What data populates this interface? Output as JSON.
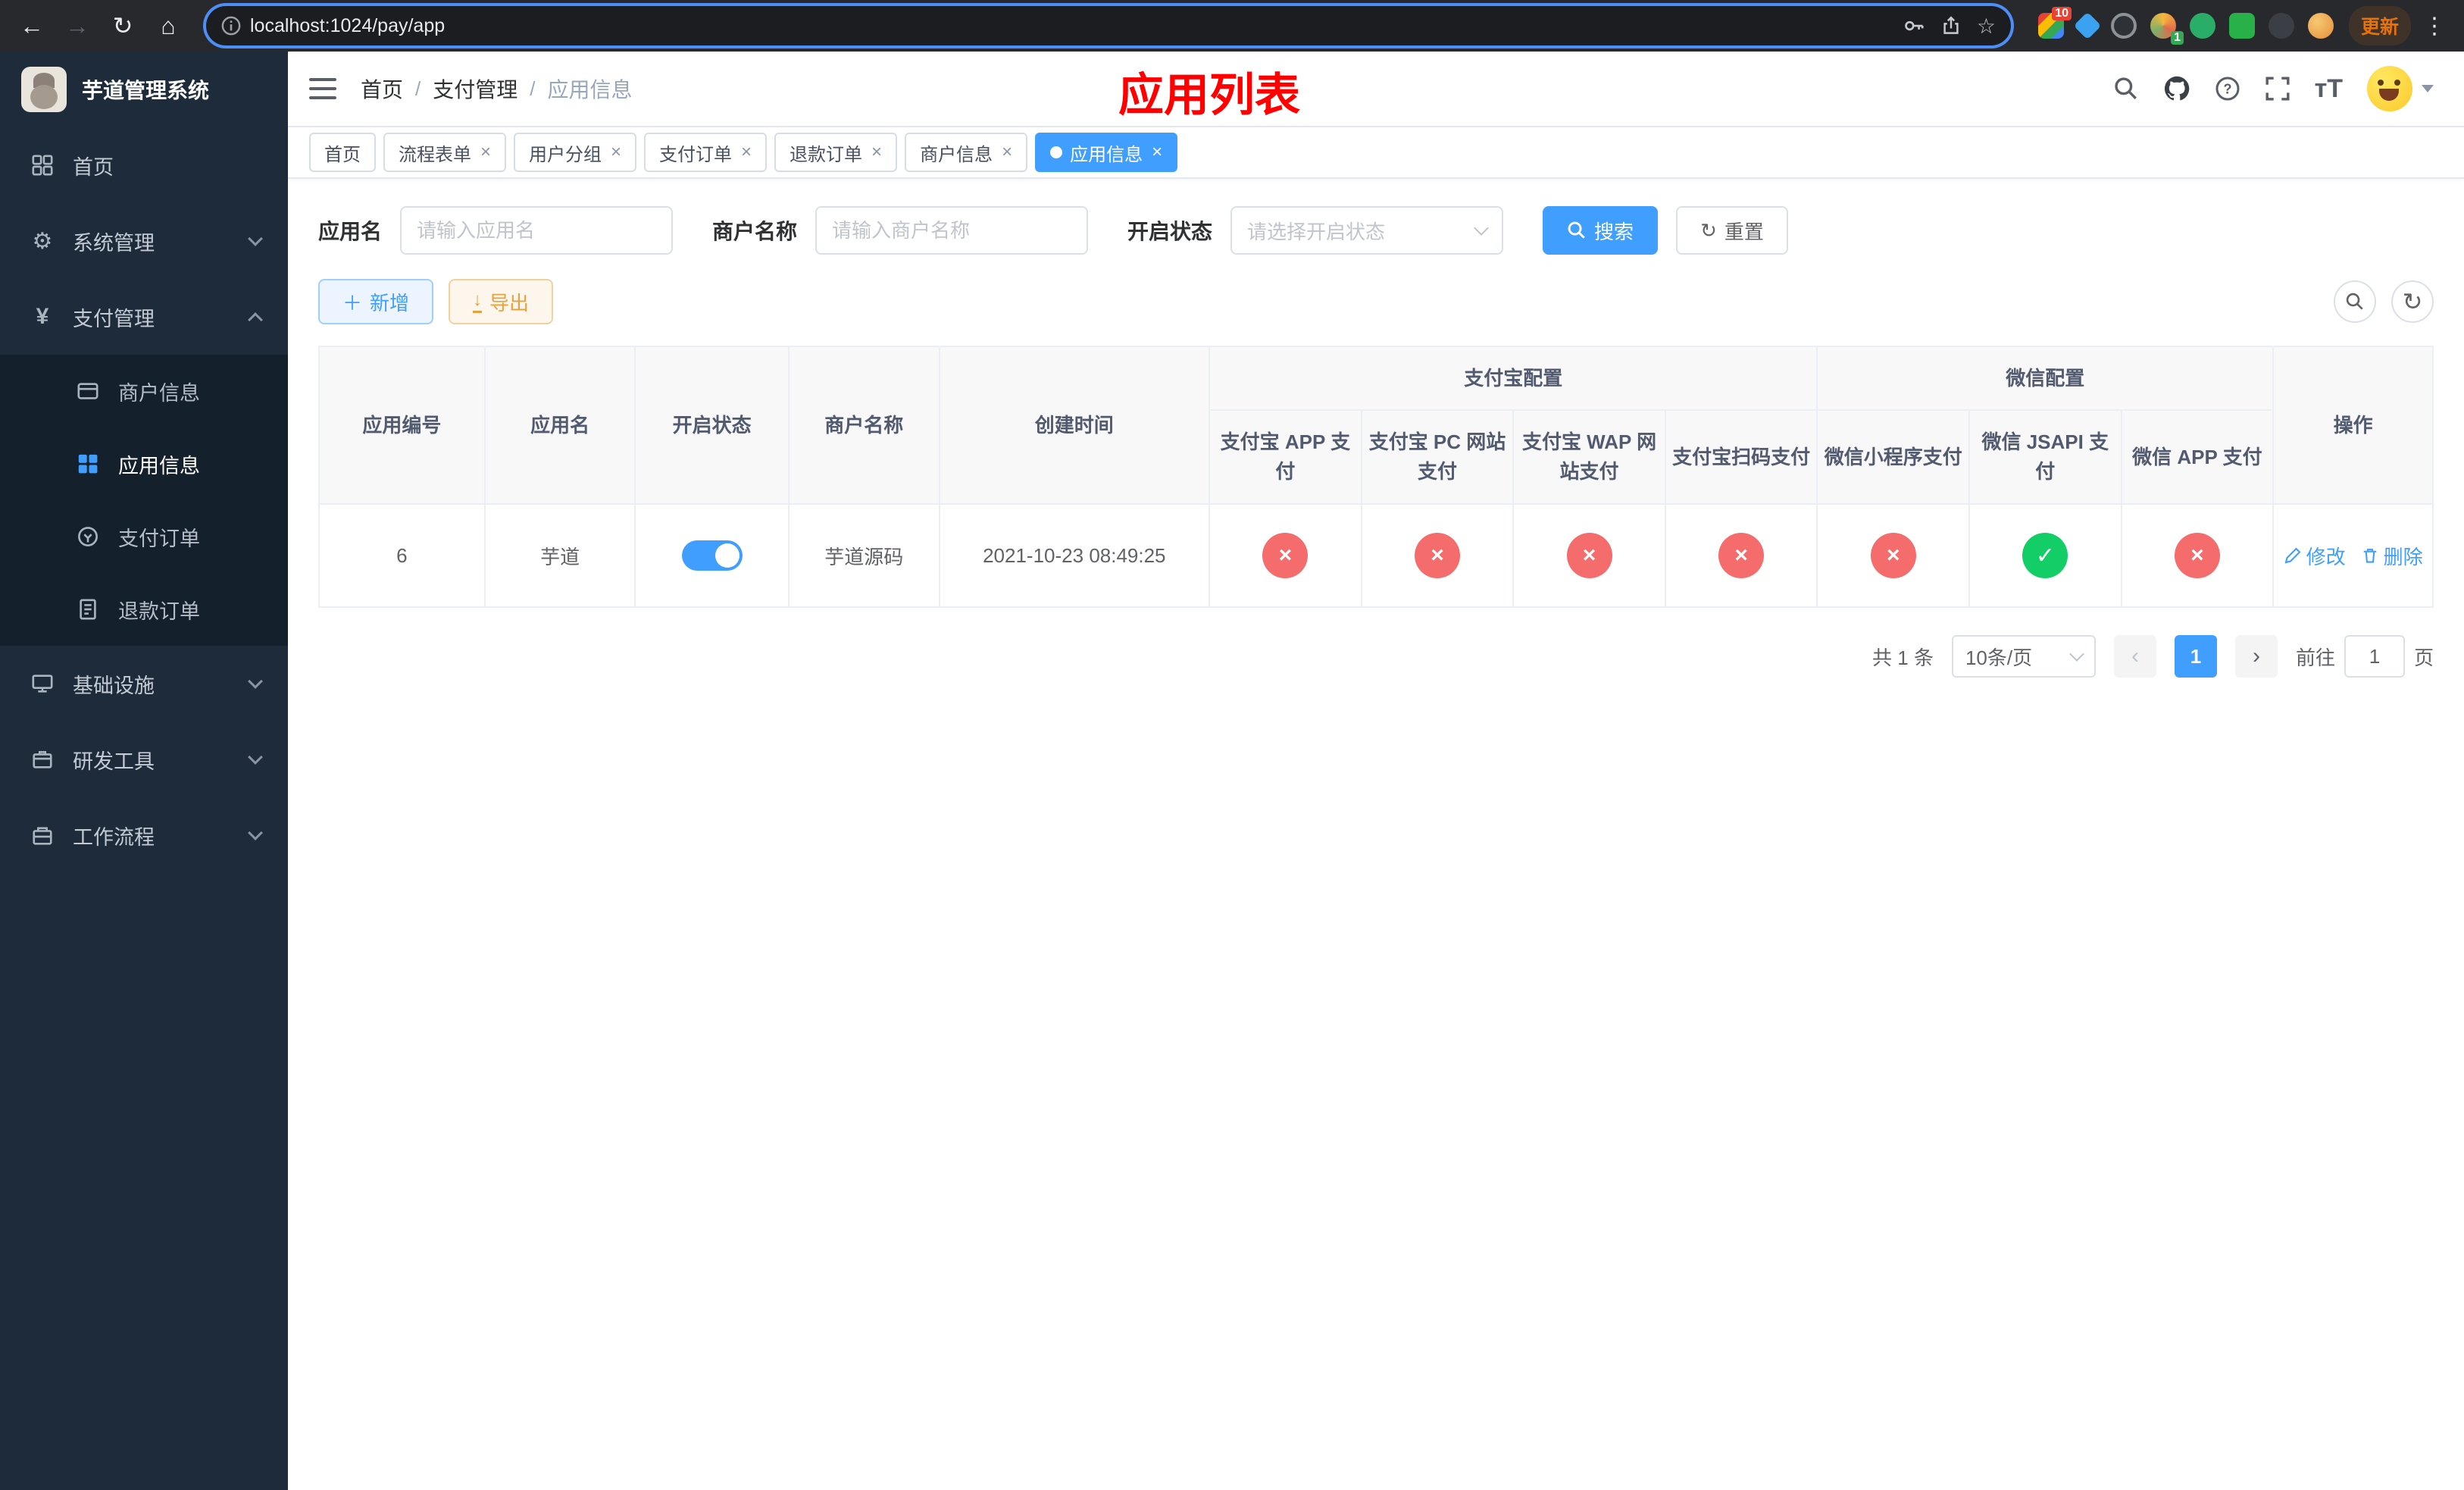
{
  "colors": {
    "accent": "#409eff",
    "danger": "#f56c6c",
    "success": "#13ce66",
    "warning": "#e6a23c",
    "title_red": "#ff0000",
    "sidebar_bg": "#1d2b3a"
  },
  "browser": {
    "url": "localhost:1024/pay/app",
    "update_button": "更新",
    "extension_badge_count": "10",
    "profile_badge_count": "1"
  },
  "sidebar": {
    "logo_title": "芋道管理系统",
    "menu": [
      {
        "label": "首页",
        "icon": "dashboard-icon",
        "expandable": false
      },
      {
        "label": "系统管理",
        "icon": "gear-icon",
        "expandable": true,
        "expanded": false
      },
      {
        "label": "支付管理",
        "icon": "yen-icon",
        "expandable": true,
        "expanded": true
      },
      {
        "label": "基础设施",
        "icon": "infrastructure-icon",
        "expandable": true,
        "expanded": false
      },
      {
        "label": "研发工具",
        "icon": "devtools-icon",
        "expandable": true,
        "expanded": false
      },
      {
        "label": "工作流程",
        "icon": "workflow-icon",
        "expandable": true,
        "expanded": false
      }
    ],
    "payment_submenu": [
      {
        "label": "商户信息",
        "active": false
      },
      {
        "label": "应用信息",
        "active": true
      },
      {
        "label": "支付订单",
        "active": false
      },
      {
        "label": "退款订单",
        "active": false
      }
    ]
  },
  "header": {
    "breadcrumb": [
      "首页",
      "支付管理",
      "应用信息"
    ],
    "page_title": "应用列表"
  },
  "tabs": [
    {
      "label": "首页",
      "closable": false,
      "active": false
    },
    {
      "label": "流程表单",
      "closable": true,
      "active": false
    },
    {
      "label": "用户分组",
      "closable": true,
      "active": false
    },
    {
      "label": "支付订单",
      "closable": true,
      "active": false
    },
    {
      "label": "退款订单",
      "closable": true,
      "active": false
    },
    {
      "label": "商户信息",
      "closable": true,
      "active": false
    },
    {
      "label": "应用信息",
      "closable": true,
      "active": true
    }
  ],
  "filters": {
    "app_name_label": "应用名",
    "app_name_placeholder": "请输入应用名",
    "merchant_label": "商户名称",
    "merchant_placeholder": "请输入商户名称",
    "status_label": "开启状态",
    "status_placeholder": "请选择开启状态",
    "search_button": "搜索",
    "reset_button": "重置"
  },
  "toolbar": {
    "add_button": "新增",
    "export_button": "导出"
  },
  "table": {
    "col_id": "应用编号",
    "col_name": "应用名",
    "col_status": "开启状态",
    "col_merchant": "商户名称",
    "col_created": "创建时间",
    "group_alipay": "支付宝配置",
    "group_wechat": "微信配置",
    "alipay_cols": [
      "支付宝 APP 支付",
      "支付宝 PC 网站支付",
      "支付宝 WAP 网站支付",
      "支付宝扫码支付"
    ],
    "wechat_cols": [
      "微信小程序支付",
      "微信 JSAPI 支付",
      "微信 APP 支付"
    ],
    "col_actions": "操作",
    "rows": [
      {
        "id": "6",
        "name": "芋道",
        "enabled": true,
        "merchant": "芋道源码",
        "created": "2021-10-23 08:49:25",
        "configs": [
          "no",
          "no",
          "no",
          "no",
          "no",
          "yes",
          "no"
        ],
        "edit_label": "修改",
        "delete_label": "删除"
      }
    ]
  },
  "pagination": {
    "total_text": "共 1 条",
    "page_size": "10条/页",
    "current_page": "1",
    "goto_label": "前往",
    "goto_value": "1",
    "page_suffix": "页"
  }
}
